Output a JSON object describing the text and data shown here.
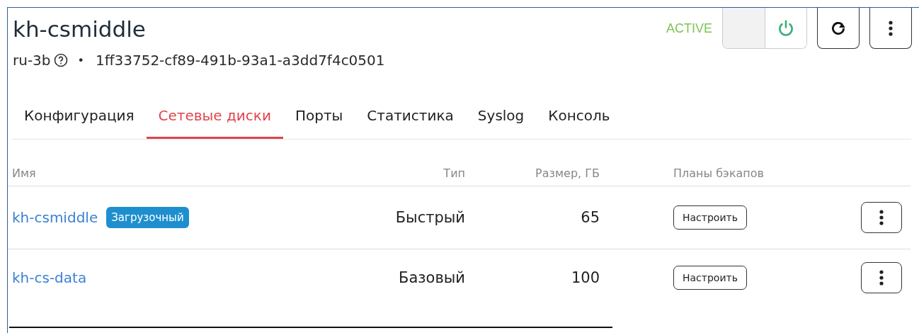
{
  "header": {
    "title": "kh-csmiddle",
    "region": "ru-3b",
    "separator": "•",
    "id": "1ff33752-cf89-491b-93a1-a3dd7f4c0501"
  },
  "status": {
    "label": "ACTIVE",
    "power_on": true
  },
  "tabs": [
    {
      "label": "Конфигурация",
      "selected": false
    },
    {
      "label": "Сетевые диски",
      "selected": true
    },
    {
      "label": "Порты",
      "selected": false
    },
    {
      "label": "Статистика",
      "selected": false
    },
    {
      "label": "Syslog",
      "selected": false
    },
    {
      "label": "Консоль",
      "selected": false
    }
  ],
  "table": {
    "columns": [
      "Имя",
      "Тип",
      "Размер, ГБ",
      "Планы бэкапов"
    ],
    "rows": [
      {
        "name": "kh-csmiddle",
        "badge": "Загрузочный",
        "type": "Быстрый",
        "size": "65",
        "backup_button": "Настроить"
      },
      {
        "name": "kh-cs-data",
        "type": "Базовый",
        "size": "100",
        "backup_button": "Настроить"
      }
    ]
  }
}
